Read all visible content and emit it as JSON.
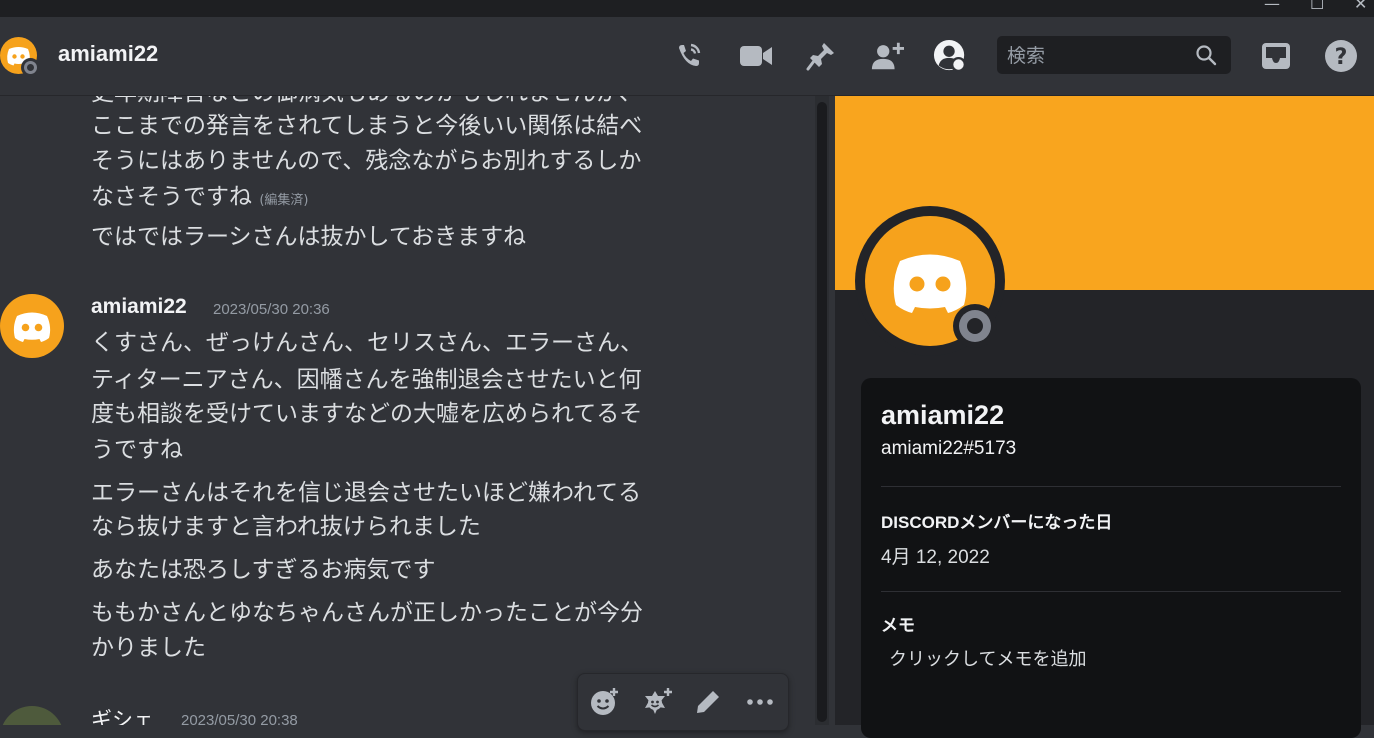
{
  "window": {
    "minimize": "—",
    "maximize": "☐",
    "close": "✕"
  },
  "header": {
    "channel_name": "amiami22",
    "search_placeholder": "検索"
  },
  "messages": {
    "group1": {
      "lines": [
        "ここまでの発言をされてしまうと今後いい関係は結べ",
        "そうにはありませんので、残念ながらお別れするしか",
        "なさそうですね",
        "ではではラーシさんは抜かしておきますね"
      ],
      "edited_label": "(編集済)"
    },
    "group2": {
      "author": "amiami22",
      "timestamp": "2023/05/30 20:36",
      "lines": [
        "くすさん、ぜっけんさん、セリスさん、エラーさん、",
        "ティターニアさん、因幡さんを強制退会させたいと何",
        "度も相談を受けていますなどの大嘘を広められてるそ",
        "うですね",
        "エラーさんはそれを信じ退会させたいほど嫌われてる",
        "なら抜けますと言われ抜けられました",
        "あなたは恐ろしすぎるお病気です",
        "ももかさんとゆなちゃんさんが正しかったことが今分",
        "かりました"
      ]
    },
    "group3": {
      "author": "ギシェ",
      "timestamp": "2023/05/30 20:38"
    }
  },
  "profile": {
    "banner_color": "#f9a51e",
    "display_name": "amiami22",
    "tag": "amiami22#5173",
    "member_since_title": "DISCORDメンバーになった日",
    "member_since_value": "4月 12, 2022",
    "note_title": "メモ",
    "note_placeholder": "クリックしてメモを追加"
  },
  "colors": {
    "accent": "#f6a21c",
    "status_offline": "#80848e"
  }
}
